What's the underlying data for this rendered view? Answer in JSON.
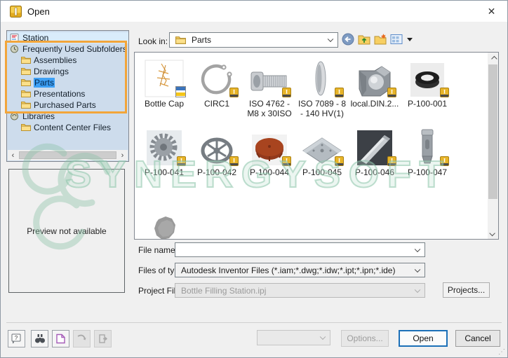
{
  "window": {
    "title": "Open"
  },
  "icons": {
    "close": "✕",
    "scroll_left": "‹",
    "scroll_right": "›",
    "help": "?",
    "resize_grip": "⋰"
  },
  "toolbar": {
    "look_in_label": "Look in:",
    "look_in_value": "Parts"
  },
  "sidebar": {
    "items": [
      {
        "label": "Station"
      },
      {
        "label": "Frequently Used Subfolders"
      },
      {
        "label": "Assemblies"
      },
      {
        "label": "Drawings"
      },
      {
        "label": "Parts"
      },
      {
        "label": "Presentations"
      },
      {
        "label": "Purchased Parts"
      },
      {
        "label": "Libraries"
      },
      {
        "label": "Content Center Files"
      }
    ]
  },
  "preview": {
    "message": "Preview not available"
  },
  "files": {
    "items": [
      {
        "name": "Bottle Cap"
      },
      {
        "name": "CIRC1"
      },
      {
        "name": "ISO 4762 - M8 x 30ISO"
      },
      {
        "name": "ISO 7089 - 8 - 140 HV(1)"
      },
      {
        "name": "local.DIN.2..."
      },
      {
        "name": "P-100-001"
      },
      {
        "name": "P-100-041"
      },
      {
        "name": "P-100-042"
      },
      {
        "name": "P-100-044"
      },
      {
        "name": "P-100-045"
      },
      {
        "name": "P-100-046"
      },
      {
        "name": "P-100-047"
      }
    ]
  },
  "form": {
    "file_name_label": "File name:",
    "file_name_value": "",
    "files_of_type_label": "Files of type:",
    "files_of_type_value": "Autodesk Inventor Files (*.iam;*.dwg;*.idw;*.ipt;*.ipn;*.ide)",
    "project_file_label": "Project File:",
    "project_file_value": "Bottle Filling Station.ipj",
    "projects_button": "Projects..."
  },
  "footer": {
    "options_button": "Options...",
    "open_button": "Open",
    "cancel_button": "Cancel"
  },
  "watermark": {
    "text": "SYNERGYSOFT"
  },
  "colors": {
    "annotation_orange": "#f2a53a",
    "selection_blue": "#3da0f5",
    "watermark_green": "#8fc3aa",
    "open_button_border": "#1c70b8"
  }
}
